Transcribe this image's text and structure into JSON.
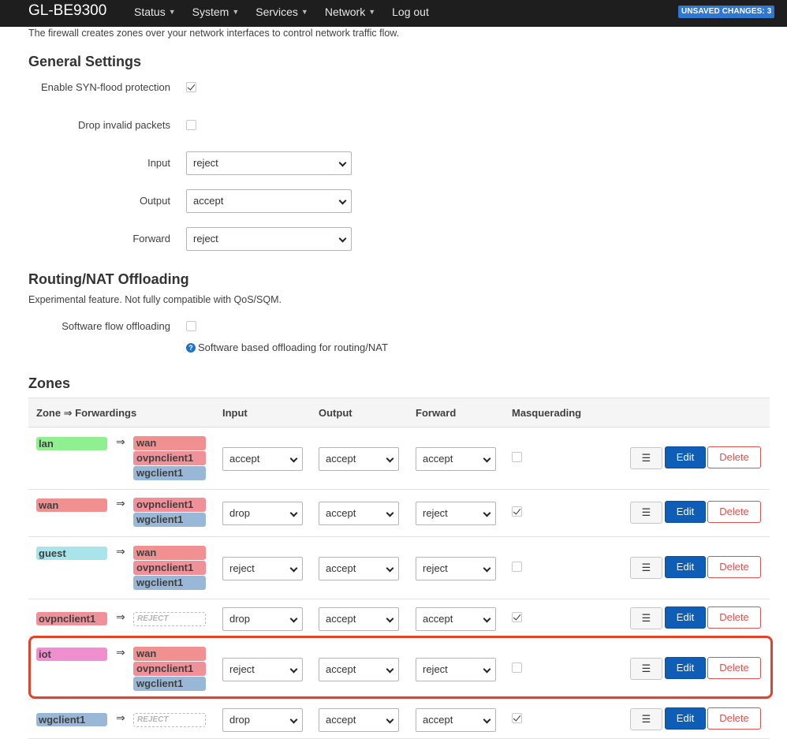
{
  "topbar": {
    "brand": "GL-BE9300",
    "nav": [
      {
        "label": "Status",
        "dropdown": true
      },
      {
        "label": "System",
        "dropdown": true
      },
      {
        "label": "Services",
        "dropdown": true
      },
      {
        "label": "Network",
        "dropdown": true
      },
      {
        "label": "Log out",
        "dropdown": false
      }
    ],
    "unsaved": "UNSAVED CHANGES: 3"
  },
  "intro": "The firewall creates zones over your network interfaces to control network traffic flow.",
  "general": {
    "title": "General Settings",
    "syn_label": "Enable SYN-flood protection",
    "syn_checked": true,
    "drop_label": "Drop invalid packets",
    "drop_checked": false,
    "input_label": "Input",
    "input_value": "reject",
    "output_label": "Output",
    "output_value": "accept",
    "forward_label": "Forward",
    "forward_value": "reject"
  },
  "offload": {
    "title": "Routing/NAT Offloading",
    "desc": "Experimental feature. Not fully compatible with QoS/SQM.",
    "sw_label": "Software flow offloading",
    "sw_checked": false,
    "sw_hint": "Software based offloading for routing/NAT",
    "help_icon": "?"
  },
  "zones": {
    "title": "Zones",
    "headers": {
      "zone": "Zone ⇒ Forwardings",
      "input": "Input",
      "output": "Output",
      "forward": "Forward",
      "masq": "Masquerading"
    },
    "arrow": "⇒",
    "reject_label": "REJECT",
    "menu_glyph": "☰",
    "edit_label": "Edit",
    "delete_label": "Delete",
    "colors": {
      "lan": "#90f090",
      "wan": "#f09090",
      "guest": "#a8e4ea",
      "ovpnclient1": "#f09098",
      "iot": "#f08ed0",
      "wgclient1": "#99b8d8"
    },
    "rows": [
      {
        "zone": "lan",
        "fwd": [
          "wan",
          "ovpnclient1",
          "wgclient1"
        ],
        "input": "accept",
        "output": "accept",
        "forward": "accept",
        "masq": false
      },
      {
        "zone": "wan",
        "fwd": [
          "ovpnclient1",
          "wgclient1"
        ],
        "input": "drop",
        "output": "accept",
        "forward": "reject",
        "masq": true
      },
      {
        "zone": "guest",
        "fwd": [
          "wan",
          "ovpnclient1",
          "wgclient1"
        ],
        "input": "reject",
        "output": "accept",
        "forward": "reject",
        "masq": false
      },
      {
        "zone": "ovpnclient1",
        "fwd": [],
        "input": "drop",
        "output": "accept",
        "forward": "accept",
        "masq": true
      },
      {
        "zone": "iot",
        "fwd": [
          "wan",
          "ovpnclient1",
          "wgclient1"
        ],
        "input": "reject",
        "output": "accept",
        "forward": "reject",
        "masq": false,
        "highlighted": true
      },
      {
        "zone": "wgclient1",
        "fwd": [],
        "input": "drop",
        "output": "accept",
        "forward": "accept",
        "masq": true
      }
    ]
  }
}
